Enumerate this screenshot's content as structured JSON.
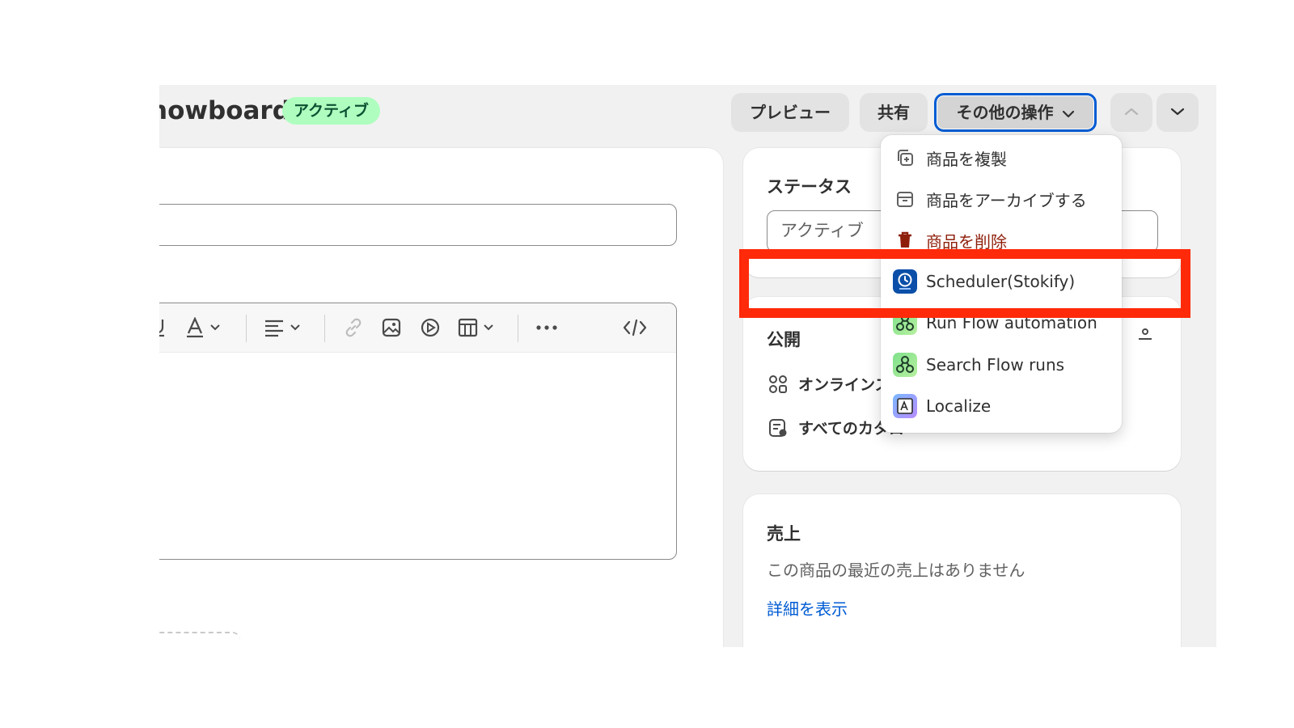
{
  "header": {
    "title": "nowboard",
    "status_badge": "アクティブ",
    "buttons": {
      "preview": "プレビュー",
      "share": "共有",
      "more_actions": "その他の操作"
    }
  },
  "status_card": {
    "heading": "ステータス",
    "selected": "アクティブ"
  },
  "publish_card": {
    "heading": "公開",
    "online_store": "オンラインス",
    "catalogs": "すべてのカタロ"
  },
  "sales_card": {
    "heading": "売上",
    "text": "この商品の最近の売上はありません",
    "link": "詳細を表示"
  },
  "menu": {
    "items": [
      {
        "label": "商品を複製",
        "icon": "duplicate-icon"
      },
      {
        "label": "商品をアーカイブする",
        "icon": "archive-icon"
      },
      {
        "label": "商品を削除",
        "icon": "delete-icon"
      },
      {
        "label": "Scheduler(Stokify)",
        "icon": "stokify-app-icon"
      },
      {
        "label": "Run Flow automation",
        "icon": "flow-app-icon"
      },
      {
        "label": "Search Flow runs",
        "icon": "flow-app-icon"
      },
      {
        "label": "Localize",
        "icon": "localize-app-icon"
      }
    ]
  },
  "colors": {
    "highlight": "#ff2a0a",
    "focus_ring": "#005bd3",
    "badge_bg": "#affebf",
    "danger": "#8e1f0b",
    "link": "#005bd3"
  }
}
